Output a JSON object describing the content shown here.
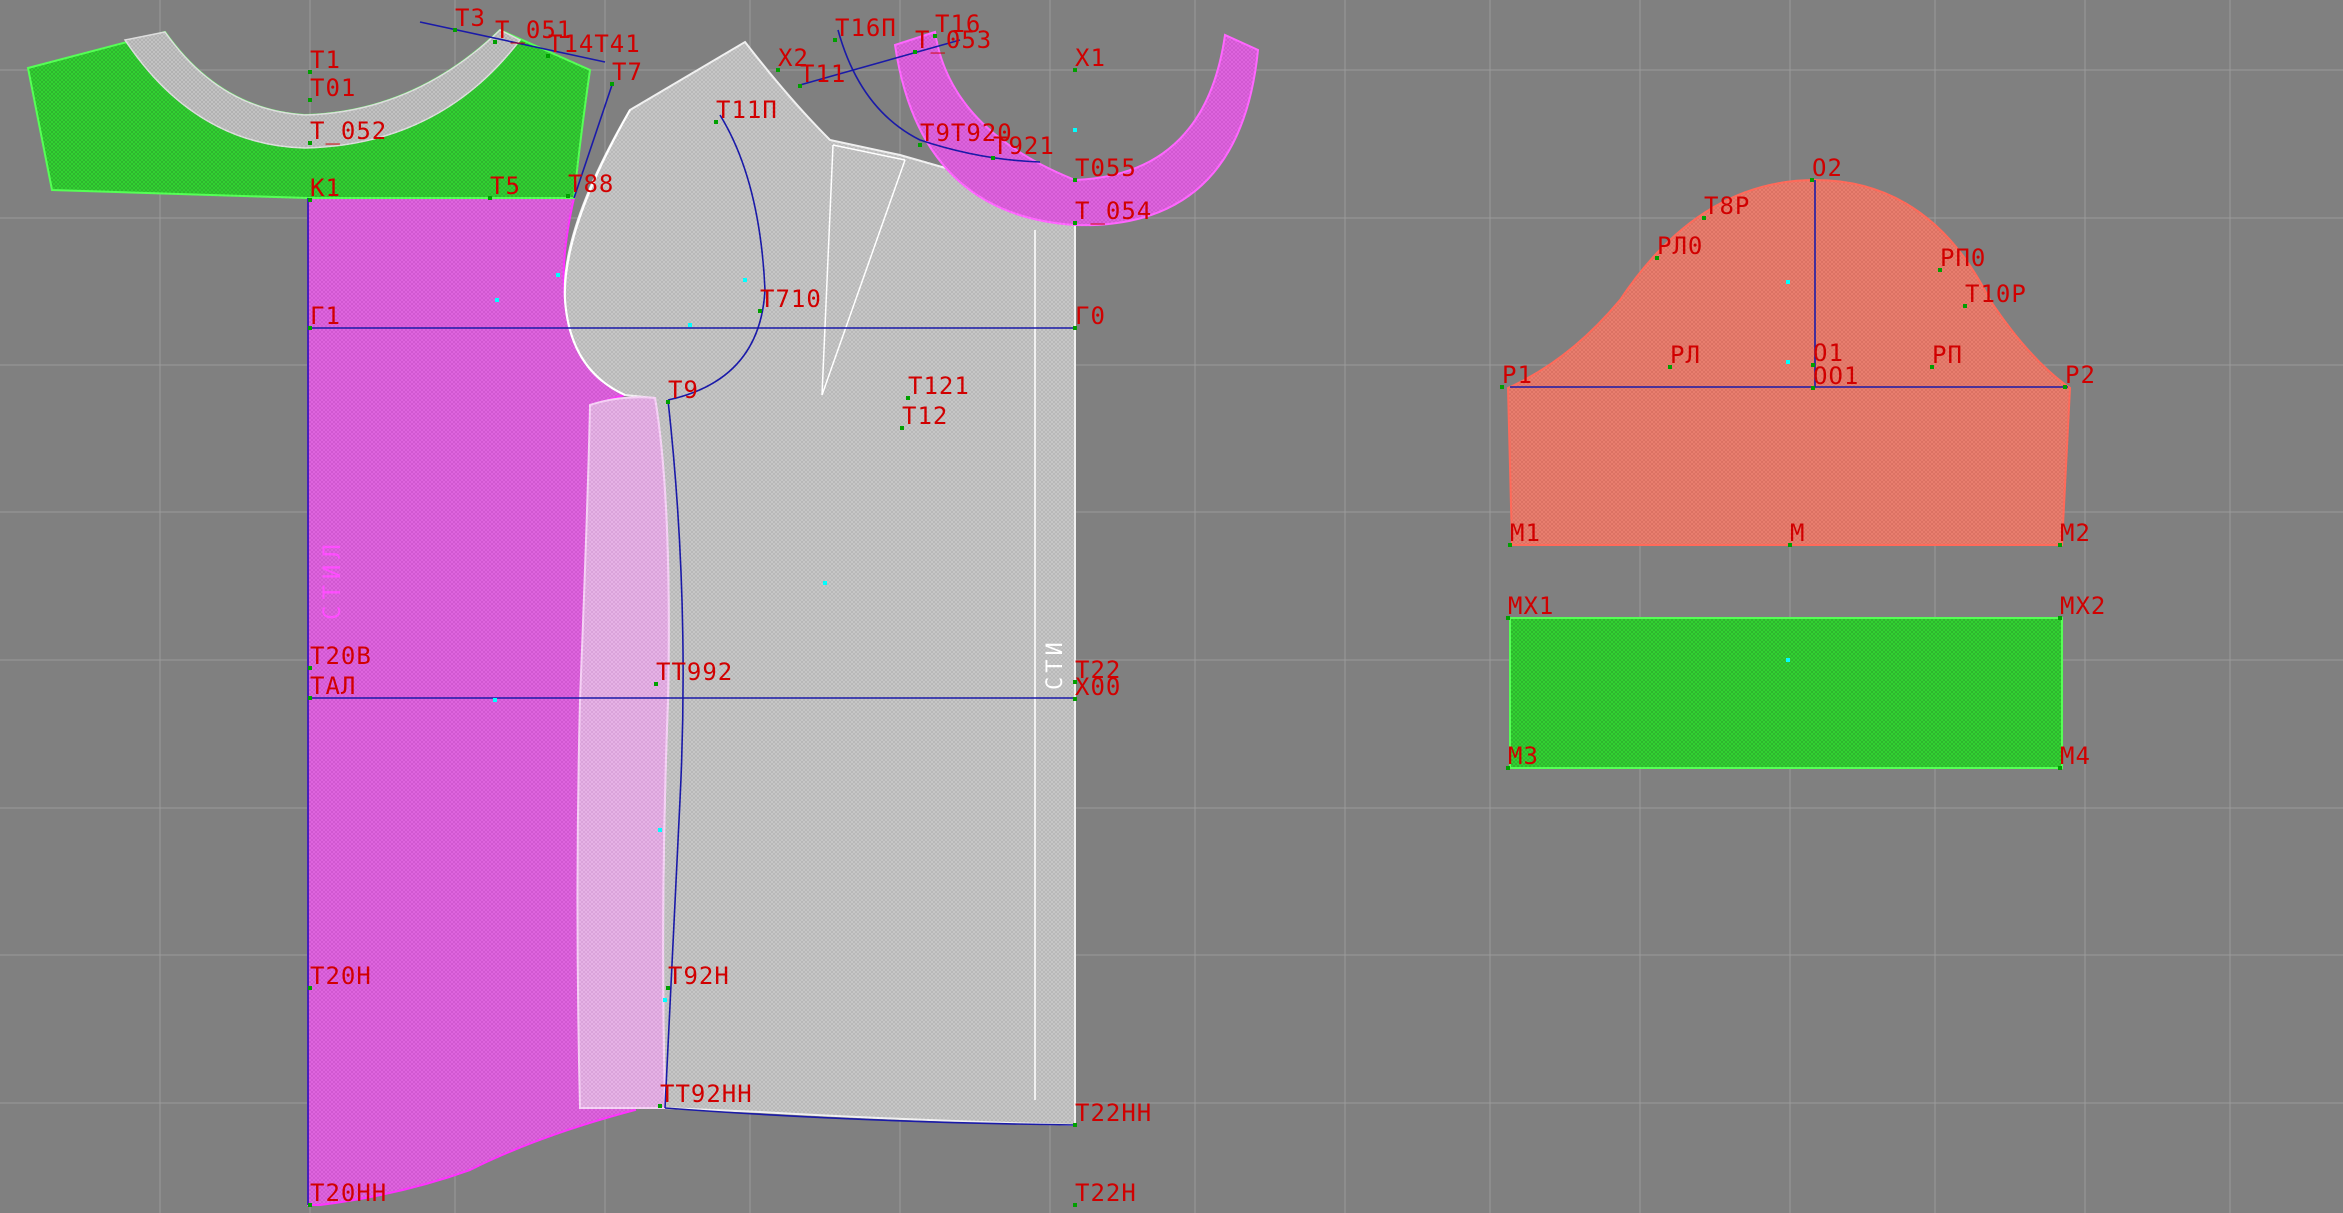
{
  "app": {
    "view": "pattern-drafting-canvas"
  },
  "colors": {
    "background": "#808080",
    "grid": "#9a9a9a",
    "label": "#d10000",
    "construction_line": "#1a1aa8",
    "point_green": "#00a000",
    "point_cyan": "#00ffff",
    "piece_green": "#33d333",
    "piece_magenta": "#e066e0",
    "piece_white": "#c8c8c8",
    "piece_salmon": "#e8806e"
  },
  "pieces": {
    "yoke_front": {
      "name": "green-yoke",
      "fill": "#33d333"
    },
    "back": {
      "name": "magenta-back",
      "fill": "#e066e0"
    },
    "front": {
      "name": "white-front",
      "fill": "#c8c8c8"
    },
    "neck_facing": {
      "name": "magenta-neck-facing",
      "fill": "#ee77ee"
    },
    "sleeve": {
      "name": "salmon-sleeve",
      "fill": "#ea7f70"
    },
    "cuff": {
      "name": "green-cuff",
      "fill": "#33d333"
    }
  },
  "vertical_labels": {
    "back_grain": "СТИЛ",
    "front_grain": "СТИ"
  },
  "point_labels": [
    {
      "id": "T1",
      "text": "Т1"
    },
    {
      "id": "T01",
      "text": "Т01"
    },
    {
      "id": "T_052",
      "text": "Т_052"
    },
    {
      "id": "K1",
      "text": "К1"
    },
    {
      "id": "T3",
      "text": "Т3"
    },
    {
      "id": "T_051",
      "text": "Т_051"
    },
    {
      "id": "T141",
      "text": "Т14Т41"
    },
    {
      "id": "T7",
      "text": "Т7"
    },
    {
      "id": "T5",
      "text": "Т5"
    },
    {
      "id": "T88",
      "text": "Т88"
    },
    {
      "id": "X2",
      "text": "Х2"
    },
    {
      "id": "T11",
      "text": "Т11"
    },
    {
      "id": "T16P",
      "text": "Т16П"
    },
    {
      "id": "T16",
      "text": "Т16"
    },
    {
      "id": "T_053",
      "text": "Т_053"
    },
    {
      "id": "X1",
      "text": "Х1"
    },
    {
      "id": "T11P",
      "text": "Т11П"
    },
    {
      "id": "T922",
      "text": "Т9Т920"
    },
    {
      "id": "T921",
      "text": "Т921"
    },
    {
      "id": "T055",
      "text": "Т055"
    },
    {
      "id": "T_054",
      "text": "Т_054"
    },
    {
      "id": "G1",
      "text": "Г1"
    },
    {
      "id": "T710",
      "text": "Т710"
    },
    {
      "id": "G0",
      "text": "Г0"
    },
    {
      "id": "T9",
      "text": "Т9"
    },
    {
      "id": "T121",
      "text": "Т121"
    },
    {
      "id": "T12",
      "text": "Т12"
    },
    {
      "id": "T20V",
      "text": "Т20В"
    },
    {
      "id": "TAL",
      "text": "ТАЛ"
    },
    {
      "id": "T992",
      "text": "ТТ992"
    },
    {
      "id": "T22",
      "text": "Т22"
    },
    {
      "id": "X00",
      "text": "Х00"
    },
    {
      "id": "T20N",
      "text": "Т20Н"
    },
    {
      "id": "T92N",
      "text": "Т92Н"
    },
    {
      "id": "T92NN",
      "text": "ТТ92НН"
    },
    {
      "id": "T22NN",
      "text": "Т22НН"
    },
    {
      "id": "T20NN",
      "text": "Т20НН"
    },
    {
      "id": "T22N",
      "text": "Т22Н"
    },
    {
      "id": "O2",
      "text": "О2"
    },
    {
      "id": "T8R",
      "text": "Т8Р"
    },
    {
      "id": "RL0",
      "text": "РЛ0"
    },
    {
      "id": "RP0",
      "text": "РП0"
    },
    {
      "id": "T10R",
      "text": "Т10Р"
    },
    {
      "id": "P1",
      "text": "Р1"
    },
    {
      "id": "RL",
      "text": "РЛ"
    },
    {
      "id": "O1",
      "text": "О1"
    },
    {
      "id": "OO1",
      "text": "ОО1"
    },
    {
      "id": "RP",
      "text": "РП"
    },
    {
      "id": "P2",
      "text": "Р2"
    },
    {
      "id": "M1",
      "text": "М1"
    },
    {
      "id": "M",
      "text": "М"
    },
    {
      "id": "M2",
      "text": "М2"
    },
    {
      "id": "MX1",
      "text": "МХ1"
    },
    {
      "id": "MX2",
      "text": "МХ2"
    },
    {
      "id": "M3",
      "text": "М3"
    },
    {
      "id": "M4",
      "text": "М4"
    }
  ]
}
